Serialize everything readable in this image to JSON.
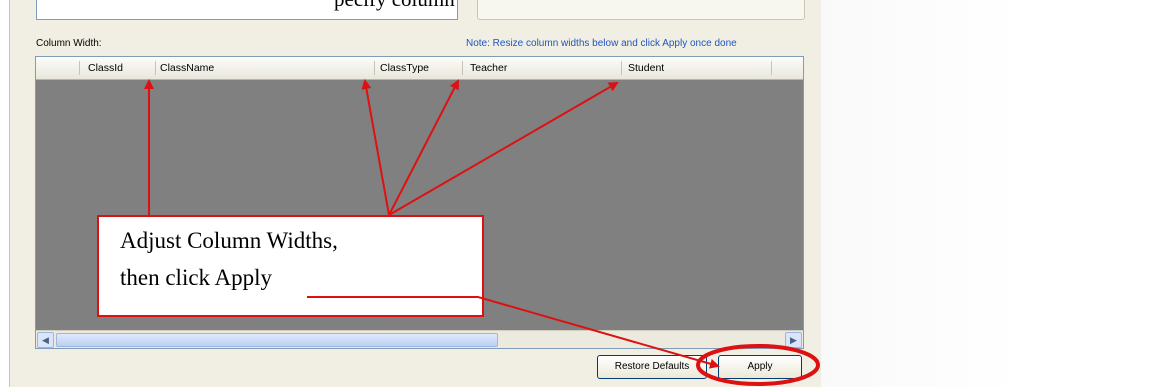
{
  "top_text": "pecify column widths, then Apply",
  "column_width_label": "Column Width:",
  "note": "Note:  Resize column widths below and click Apply once done",
  "columns": [
    "ClassId",
    "ClassName",
    "ClassType",
    "Teacher",
    "Student"
  ],
  "buttons": {
    "restore": "Restore Defaults",
    "apply": "Apply"
  },
  "callout": {
    "line1": "Adjust Column Widths,",
    "line2": "then click Apply"
  },
  "colors": {
    "annotation_red": "#dd1111",
    "grid_background": "#808080",
    "note_blue": "#1f55c2"
  },
  "icons": {
    "scroll_left": "arrow-left-icon",
    "scroll_right": "arrow-right-icon"
  }
}
